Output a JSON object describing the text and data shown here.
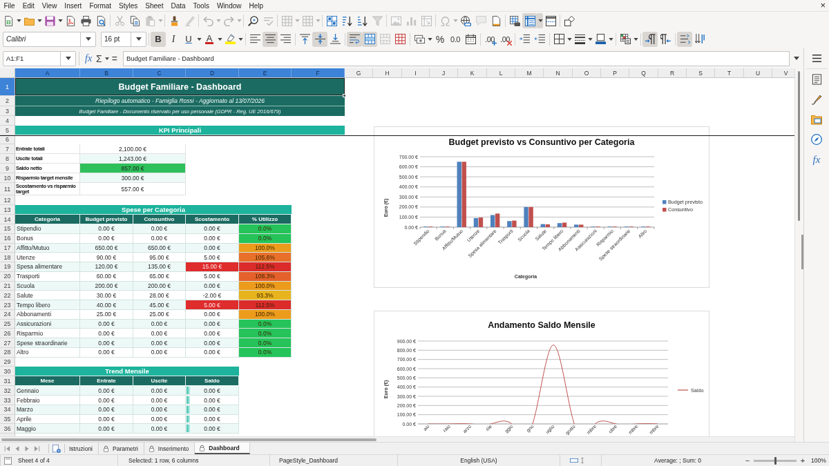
{
  "menu_bar": {
    "items": [
      "File",
      "Edit",
      "View",
      "Insert",
      "Format",
      "Styles",
      "Sheet",
      "Data",
      "Tools",
      "Window",
      "Help"
    ],
    "close": "×"
  },
  "standard_toolbar": {
    "buttons": [
      {
        "pressed": false,
        "disabled": false
      },
      {
        "pressed": false,
        "disabled": false
      },
      {
        "pressed": false,
        "disabled": false
      },
      {
        "pressed": false,
        "disabled": false
      },
      {
        "pressed": false,
        "disabled": false
      },
      {
        "pressed": false,
        "disabled": false
      },
      {
        "pressed": false,
        "disabled": true
      },
      {
        "pressed": false,
        "disabled": false
      },
      {
        "pressed": false,
        "disabled": true
      },
      {
        "pressed": false,
        "disabled": false
      },
      {
        "pressed": false,
        "disabled": true
      },
      {
        "pressed": false,
        "disabled": true
      },
      {
        "pressed": false,
        "disabled": true
      },
      {
        "pressed": false,
        "disabled": false
      },
      {
        "pressed": false,
        "disabled": true
      },
      {
        "pressed": false,
        "disabled": true
      },
      {
        "pressed": false,
        "disabled": true
      },
      {
        "pressed": false,
        "disabled": false
      },
      {
        "pressed": false,
        "disabled": false
      },
      {
        "pressed": false,
        "disabled": false
      },
      {
        "pressed": false,
        "disabled": true
      },
      {
        "pressed": false,
        "disabled": true
      },
      {
        "pressed": false,
        "disabled": true
      },
      {
        "pressed": false,
        "disabled": true
      },
      {
        "pressed": false,
        "disabled": true
      },
      {
        "pressed": false,
        "disabled": false
      },
      {
        "pressed": false,
        "disabled": true
      },
      {
        "pressed": false,
        "disabled": false
      },
      {
        "pressed": false,
        "disabled": false
      },
      {
        "pressed": true,
        "disabled": false
      },
      {
        "pressed": false,
        "disabled": false
      },
      {
        "pressed": false,
        "disabled": false
      }
    ]
  },
  "formatting_toolbar": {
    "font_name": "Calibri",
    "font_size": "16 pt",
    "buttons": [
      {
        "label": "B",
        "pressed": true,
        "disabled": false
      },
      {
        "label": "I",
        "pressed": false,
        "disabled": false
      },
      {
        "label": "U",
        "pressed": false,
        "disabled": false
      },
      {
        "label": "A",
        "pressed": false,
        "disabled": false
      },
      {
        "pressed": false,
        "disabled": false
      },
      {
        "pressed": false,
        "disabled": false
      },
      {
        "pressed": true,
        "disabled": false
      },
      {
        "pressed": false,
        "disabled": false
      },
      {
        "pressed": false,
        "disabled": false
      },
      {
        "pressed": true,
        "disabled": false
      },
      {
        "pressed": false,
        "disabled": false
      },
      {
        "pressed": true,
        "disabled": false
      },
      {
        "pressed": true,
        "disabled": false
      },
      {
        "pressed": false,
        "disabled": true
      },
      {
        "pressed": false,
        "disabled": false
      },
      {
        "pressed": false,
        "disabled": false
      },
      {
        "label": "%",
        "pressed": false,
        "disabled": false
      },
      {
        "label": "0.0",
        "pressed": false,
        "disabled": false
      },
      {
        "pressed": false,
        "disabled": false
      },
      {
        "label": ".00",
        "pressed": false,
        "disabled": false
      },
      {
        "label": ".00",
        "pressed": false,
        "disabled": false
      },
      {
        "pressed": false,
        "disabled": false
      },
      {
        "pressed": false,
        "disabled": false
      },
      {
        "pressed": false,
        "disabled": false
      },
      {
        "pressed": false,
        "disabled": false
      },
      {
        "pressed": false,
        "disabled": false
      },
      {
        "pressed": false,
        "disabled": false
      },
      {
        "pressed": true,
        "disabled": false
      },
      {
        "pressed": false,
        "disabled": false
      },
      {
        "pressed": true,
        "disabled": false
      },
      {
        "pressed": false,
        "disabled": false
      }
    ]
  },
  "formula_bar": {
    "name_box": "A1:F1",
    "symbols": [
      "fx",
      "Σ",
      "="
    ],
    "content": "Budget Familiare - Dashboard"
  },
  "sheet": {
    "columns": [
      {
        "label": "A",
        "selected": true
      },
      {
        "label": "B",
        "selected": true
      },
      {
        "label": "C",
        "selected": true
      },
      {
        "label": "D",
        "selected": true
      },
      {
        "label": "E",
        "selected": true
      },
      {
        "label": "F",
        "selected": true
      },
      {
        "label": "G",
        "selected": false
      },
      {
        "label": "H",
        "selected": false
      },
      {
        "label": "I",
        "selected": false
      },
      {
        "label": "J",
        "selected": false
      },
      {
        "label": "K",
        "selected": false
      },
      {
        "label": "L",
        "selected": false
      },
      {
        "label": "M",
        "selected": false
      },
      {
        "label": "N",
        "selected": false
      },
      {
        "label": "O",
        "selected": false
      },
      {
        "label": "P",
        "selected": false
      },
      {
        "label": "Q",
        "selected": false
      },
      {
        "label": "R",
        "selected": false
      },
      {
        "label": "S",
        "selected": false
      },
      {
        "label": "T",
        "selected": false
      },
      {
        "label": "U",
        "selected": false
      },
      {
        "label": "V",
        "selected": false
      }
    ],
    "rows": [
      {
        "label": "1",
        "selected": true
      },
      {
        "label": "2",
        "selected": false
      },
      {
        "label": "3",
        "selected": false
      },
      {
        "label": "4",
        "selected": false
      },
      {
        "label": "5",
        "selected": false
      },
      {
        "label": "6",
        "selected": false
      },
      {
        "label": "7",
        "selected": false
      },
      {
        "label": "8",
        "selected": false
      },
      {
        "label": "9",
        "selected": false
      },
      {
        "label": "10",
        "selected": false
      },
      {
        "label": "11",
        "selected": false
      },
      {
        "label": "12",
        "selected": false
      },
      {
        "label": "13",
        "selected": false
      },
      {
        "label": "14",
        "selected": false
      },
      {
        "label": "15",
        "selected": false
      },
      {
        "label": "16",
        "selected": false
      },
      {
        "label": "17",
        "selected": false
      },
      {
        "label": "18",
        "selected": false
      },
      {
        "label": "19",
        "selected": false
      },
      {
        "label": "20",
        "selected": false
      },
      {
        "label": "21",
        "selected": false
      },
      {
        "label": "22",
        "selected": false
      },
      {
        "label": "23",
        "selected": false
      },
      {
        "label": "24",
        "selected": false
      },
      {
        "label": "25",
        "selected": false
      },
      {
        "label": "26",
        "selected": false
      },
      {
        "label": "27",
        "selected": false
      },
      {
        "label": "28",
        "selected": false
      },
      {
        "label": "29",
        "selected": false
      },
      {
        "label": "30",
        "selected": false
      },
      {
        "label": "31",
        "selected": false
      },
      {
        "label": "32",
        "selected": false
      },
      {
        "label": "33",
        "selected": false
      },
      {
        "label": "34",
        "selected": false
      },
      {
        "label": "35",
        "selected": false
      },
      {
        "label": "36",
        "selected": false
      }
    ],
    "title": {
      "text": "Budget Familiare - Dashboard",
      "selected": true
    },
    "subtitle": "Riepilogo automatico - Famiglia Rossi - Aggiornato al 13/07/2026",
    "notice": "Budget Familiare - Documento riservato per uso personale (GDPR - Reg. UE 2016/679)",
    "kpi": {
      "title": "KPI Principali",
      "items": [
        {
          "label": "Entrate totali",
          "value": "2,100.00 €"
        },
        {
          "label": "Uscite totali",
          "value": "1,243.00 €"
        },
        {
          "label": "Saldo netto",
          "value": "857.00 €",
          "color": "#2ec05a"
        },
        {
          "label": "Risparmio target mensile",
          "value": "300.00 €"
        },
        {
          "label": "Scostamento vs risparmio target",
          "value": "557.00 €"
        }
      ]
    },
    "expenses": {
      "title": "Spese per Categoria",
      "columns": [
        "Categoria",
        "Budget previsto",
        "Consuntivo",
        "Scostamento",
        "% Utilizzo"
      ],
      "rows": [
        {
          "cells": [
            {
              "text": "Stipendio"
            },
            {
              "text": "0.00 €"
            },
            {
              "text": "0.00 €"
            },
            {
              "text": "0.00 €"
            },
            {
              "text": "0.0%",
              "color": "#25c35a"
            }
          ]
        },
        {
          "cells": [
            {
              "text": "Bonus"
            },
            {
              "text": "0.00 €"
            },
            {
              "text": "0.00 €"
            },
            {
              "text": "0.00 €"
            },
            {
              "text": "0.0%",
              "color": "#25c35a"
            }
          ]
        },
        {
          "cells": [
            {
              "text": "Affitto/Mutuo"
            },
            {
              "text": "650.00 €"
            },
            {
              "text": "650.00 €"
            },
            {
              "text": "0.00 €"
            },
            {
              "text": "100.0%",
              "color": "#ec9b1b"
            }
          ]
        },
        {
          "cells": [
            {
              "text": "Utenze"
            },
            {
              "text": "90.00 €"
            },
            {
              "text": "95.00 €"
            },
            {
              "text": "5.00 €"
            },
            {
              "text": "105.6%",
              "color": "#e8702a"
            }
          ]
        },
        {
          "cells": [
            {
              "text": "Spesa alimentare"
            },
            {
              "text": "120.00 €"
            },
            {
              "text": "135.00 €"
            },
            {
              "text": "15.00 €",
              "color": "#df2c2c"
            },
            {
              "text": "112.5%",
              "color": "#dc2b2b"
            }
          ]
        },
        {
          "cells": [
            {
              "text": "Trasporti"
            },
            {
              "text": "60.00 €"
            },
            {
              "text": "65.00 €"
            },
            {
              "text": "5.00 €"
            },
            {
              "text": "108.3%",
              "color": "#e5602b"
            }
          ]
        },
        {
          "cells": [
            {
              "text": "Scuola"
            },
            {
              "text": "200.00 €"
            },
            {
              "text": "200.00 €"
            },
            {
              "text": "0.00 €"
            },
            {
              "text": "100.0%",
              "color": "#ec9b1b"
            }
          ]
        },
        {
          "cells": [
            {
              "text": "Salute"
            },
            {
              "text": "30.00 €"
            },
            {
              "text": "28.00 €"
            },
            {
              "text": "-2.00 €"
            },
            {
              "text": "93.3%",
              "color": "#e8b41d"
            }
          ]
        },
        {
          "cells": [
            {
              "text": "Tempo libero"
            },
            {
              "text": "40.00 €"
            },
            {
              "text": "45.00 €"
            },
            {
              "text": "5.00 €",
              "color": "#df2c2c"
            },
            {
              "text": "112.5%",
              "color": "#dc2b2b"
            }
          ]
        },
        {
          "cells": [
            {
              "text": "Abbonamenti"
            },
            {
              "text": "25.00 €"
            },
            {
              "text": "25.00 €"
            },
            {
              "text": "0.00 €"
            },
            {
              "text": "100.0%",
              "color": "#ec9b1b"
            }
          ]
        },
        {
          "cells": [
            {
              "text": "Assicurazioni"
            },
            {
              "text": "0.00 €"
            },
            {
              "text": "0.00 €"
            },
            {
              "text": "0.00 €"
            },
            {
              "text": "0.0%",
              "color": "#25c35a"
            }
          ]
        },
        {
          "cells": [
            {
              "text": "Risparmio"
            },
            {
              "text": "0.00 €"
            },
            {
              "text": "0.00 €"
            },
            {
              "text": "0.00 €"
            },
            {
              "text": "0.0%",
              "color": "#25c35a"
            }
          ]
        },
        {
          "cells": [
            {
              "text": "Spese straordinarie"
            },
            {
              "text": "0.00 €"
            },
            {
              "text": "0.00 €"
            },
            {
              "text": "0.00 €"
            },
            {
              "text": "0.0%",
              "color": "#25c35a"
            }
          ]
        },
        {
          "cells": [
            {
              "text": "Altro"
            },
            {
              "text": "0.00 €"
            },
            {
              "text": "0.00 €"
            },
            {
              "text": "0.00 €"
            },
            {
              "text": "0.0%",
              "color": "#25c35a"
            }
          ]
        }
      ]
    },
    "trend": {
      "title": "Trend Mensile",
      "columns": [
        "Mese",
        "Entrate",
        "Uscite",
        "Saldo"
      ],
      "rows": [
        {
          "cells": [
            "Gennaio",
            "0.00 €",
            "0.00 €",
            "0.00 €"
          ],
          "level": 0
        },
        {
          "cells": [
            "Febbraio",
            "0.00 €",
            "0.00 €",
            "0.00 €"
          ],
          "level": 0
        },
        {
          "cells": [
            "Marzo",
            "0.00 €",
            "0.00 €",
            "0.00 €"
          ],
          "level": 0
        },
        {
          "cells": [
            "Aprile",
            "0.00 €",
            "0.00 €",
            "0.00 €"
          ],
          "level": 0
        },
        {
          "cells": [
            "Maggio",
            "0.00 €",
            "0.00 €",
            "0.00 €"
          ],
          "level": 0
        }
      ]
    }
  },
  "charts": [
    {
      "chart_data": {
        "type": "bar",
        "title": "Budget previsto vs Consuntivo per Categoria",
        "xlabel": "Categoria",
        "ylabel": "Euro (€)",
        "categories": [
          "Stipendio",
          "Bonus",
          "Affitto/Mutuo",
          "Utenze",
          "Spesa alimentare",
          "Trasporti",
          "Scuola",
          "Salute",
          "Tempo libero",
          "Abbonamenti",
          "Assicurazioni",
          "Risparmio",
          "Spese straordinarie",
          "Altro"
        ],
        "series": [
          {
            "name": "Budget previsto",
            "color": "#4f81bd",
            "values": [
              0,
              0,
              650,
              90,
              120,
              60,
              200,
              30,
              40,
              25,
              0,
              0,
              0,
              0
            ]
          },
          {
            "name": "Consuntivo",
            "color": "#c0504d",
            "values": [
              0,
              0,
              650,
              95,
              135,
              65,
              200,
              28,
              45,
              25,
              0,
              0,
              0,
              0
            ]
          }
        ],
        "ylim": [
          0,
          700
        ],
        "yticks": [
          {
            "value": 0,
            "label": "0.00 €"
          },
          {
            "value": 100,
            "label": "100.00 €"
          },
          {
            "value": 200,
            "label": "200.00 €"
          },
          {
            "value": 300,
            "label": "300.00 €"
          },
          {
            "value": 400,
            "label": "400.00 €"
          },
          {
            "value": 500,
            "label": "500.00 €"
          },
          {
            "value": 600,
            "label": "600.00 €"
          },
          {
            "value": 700,
            "label": "700.00 €"
          }
        ],
        "grid": true,
        "legend": true
      }
    },
    {
      "chart_data": {
        "type": "line",
        "title": "Andamento Saldo Mensile",
        "ylabel": "Euro (€)",
        "categories": [
          "aio",
          "raio",
          "arzo",
          "rile",
          "ggio",
          "gno",
          "uglio",
          "gosto",
          "mbre",
          "obre",
          "mbre",
          "mbre"
        ],
        "series": [
          {
            "name": "Saldo",
            "color": "#c0504d",
            "values": [
              0,
              0,
              0,
              0,
              0,
              0,
              857,
              0,
              0,
              0,
              0,
              0
            ]
          }
        ],
        "ylim": [
          0,
          900
        ],
        "yticks": [
          {
            "value": 0,
            "label": "0.00 €"
          },
          {
            "value": 100,
            "label": "100.00 €"
          },
          {
            "value": 200,
            "label": "200.00 €"
          },
          {
            "value": 300,
            "label": "300.00 €"
          },
          {
            "value": 400,
            "label": "400.00 €"
          },
          {
            "value": 500,
            "label": "500.00 €"
          },
          {
            "value": 600,
            "label": "600.00 €"
          },
          {
            "value": 700,
            "label": "700.00 €"
          },
          {
            "value": 800,
            "label": "800.00 €"
          },
          {
            "value": 900,
            "label": "900.00 €"
          }
        ],
        "grid": true,
        "legend": true
      }
    }
  ],
  "sidebar": {
    "functions_label": "fx"
  },
  "sheet_tabs": [
    {
      "label": "Istruzioni",
      "protected": false,
      "selected": false
    },
    {
      "label": "Parametri",
      "protected": true,
      "selected": false
    },
    {
      "label": "Inserimento",
      "protected": true,
      "selected": false
    },
    {
      "label": "Dashboard",
      "protected": true,
      "selected": true
    }
  ],
  "status_bar": {
    "sheet": "Sheet 4 of 4",
    "selection": "Selected: 1 row, 6 columns",
    "page_style": "PageStyle_Dashboard",
    "language": "English (USA)",
    "summary": "Average: ; Sum: 0",
    "zoom": {
      "out": "−",
      "in": "+",
      "level": 0.5,
      "reading": "100%"
    }
  }
}
